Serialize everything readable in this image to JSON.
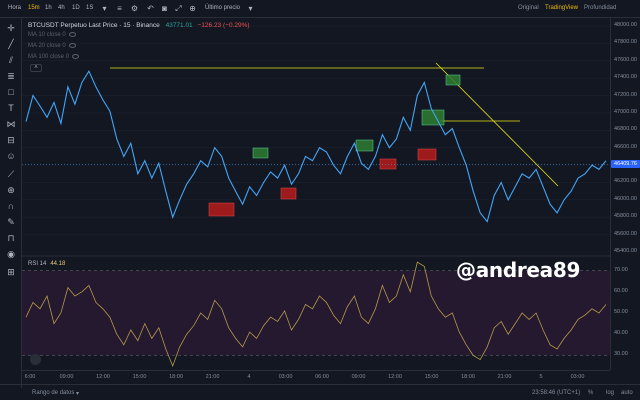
{
  "toolbar": {
    "timeframes": [
      {
        "label": "Hora",
        "active": false
      },
      {
        "label": "15m",
        "active": true
      },
      {
        "label": "1h",
        "active": false
      },
      {
        "label": "4h",
        "active": false
      },
      {
        "label": "1D",
        "active": false
      },
      {
        "label": "1S",
        "active": false
      }
    ],
    "price_type": "Último precio",
    "views": [
      {
        "label": "Original",
        "active": false
      },
      {
        "label": "TradingView",
        "active": true
      },
      {
        "label": "Profundidad",
        "active": false
      }
    ]
  },
  "legend": {
    "symbol": "BTCUSDT Perpetuo Last Price · 15 · Binance",
    "price": "43771.01",
    "change": "−126.23 (−0.29%)",
    "ma": [
      "MA 10 close 0",
      "MA 20 close 0",
      "MA 100 close 0"
    ]
  },
  "price_axis": {
    "ticks": [
      "48000.00",
      "47800.00",
      "47600.00",
      "47400.00",
      "47200.00",
      "47000.00",
      "46800.00",
      "46600.00",
      "46400.00",
      "46200.00",
      "46000.00",
      "45800.00",
      "45600.00",
      "45400.00"
    ],
    "current": "46409.76"
  },
  "rsi": {
    "label": "RSI 14",
    "value": "44.18",
    "ticks": [
      "70.00",
      "60.00",
      "50.00",
      "40.00",
      "30.00"
    ]
  },
  "watermark": "@andrea89",
  "time_axis": {
    "ticks": [
      "6:00",
      "09:00",
      "12:00",
      "15:00",
      "18:00",
      "21:00",
      "4",
      "03:00",
      "06:00",
      "09:00",
      "12:00",
      "15:00",
      "18:00",
      "21:00",
      "5",
      "03:00"
    ]
  },
  "bottom": {
    "range_label": "Rango de datos",
    "clock": "23:58:46 (UTC+1)",
    "percent": "%",
    "log": "log",
    "auto": "auto"
  },
  "colors": {
    "background": "#131722",
    "price_line": "#42a5f5",
    "trendline": "#e6e617",
    "rsi_line": "#b5994a",
    "rsi_band": "#2a1a33",
    "supply_box": "#b71c1c",
    "demand_box": "#2e7d32",
    "accent": "#f0b90b"
  },
  "chart_data": {
    "type": "line",
    "series": [
      {
        "values": [
          46900,
          47200,
          47080,
          46950,
          47120,
          46880,
          47300,
          47100,
          47350,
          47480,
          47300,
          47150,
          47020,
          46700,
          46500,
          46650,
          46300,
          46450,
          46250,
          46420,
          46100,
          45800,
          46000,
          46180,
          46300,
          46450,
          46380,
          46600,
          46500,
          46250,
          46100,
          45950,
          46150,
          46050,
          46200,
          46320,
          46250,
          46400,
          46180,
          46300,
          46500,
          46450,
          46600,
          46550,
          46400,
          46300,
          46500,
          46650,
          46420,
          46350,
          46500,
          46750,
          46600,
          46700,
          46950,
          46800,
          47200,
          47350,
          47050,
          46900,
          46750,
          46820,
          46600,
          46400,
          46100,
          45850,
          45750,
          46050,
          46200,
          46000,
          46150,
          46300,
          46250,
          46350,
          46150,
          45950,
          45850,
          46000,
          46100,
          46250,
          46300,
          46400,
          46350,
          46450
        ]
      }
    ],
    "rsi_values": [
      48,
      55,
      52,
      58,
      45,
      50,
      62,
      58,
      60,
      63,
      55,
      52,
      48,
      40,
      35,
      42,
      37,
      45,
      38,
      43,
      33,
      25,
      34,
      40,
      44,
      50,
      47,
      56,
      52,
      43,
      38,
      34,
      41,
      38,
      44,
      48,
      46,
      51,
      42,
      47,
      54,
      52,
      58,
      55,
      49,
      45,
      53,
      58,
      48,
      45,
      52,
      63,
      55,
      58,
      68,
      60,
      74,
      72,
      58,
      52,
      48,
      50,
      41,
      35,
      30,
      28,
      34,
      43,
      46,
      40,
      45,
      50,
      47,
      50,
      42,
      35,
      33,
      38,
      42,
      47,
      49,
      52,
      50,
      54
    ],
    "ylim": [
      45400,
      48000
    ],
    "rsi_ylim": [
      25,
      75
    ],
    "rsi_levels": [
      70,
      30
    ],
    "grid": true
  }
}
